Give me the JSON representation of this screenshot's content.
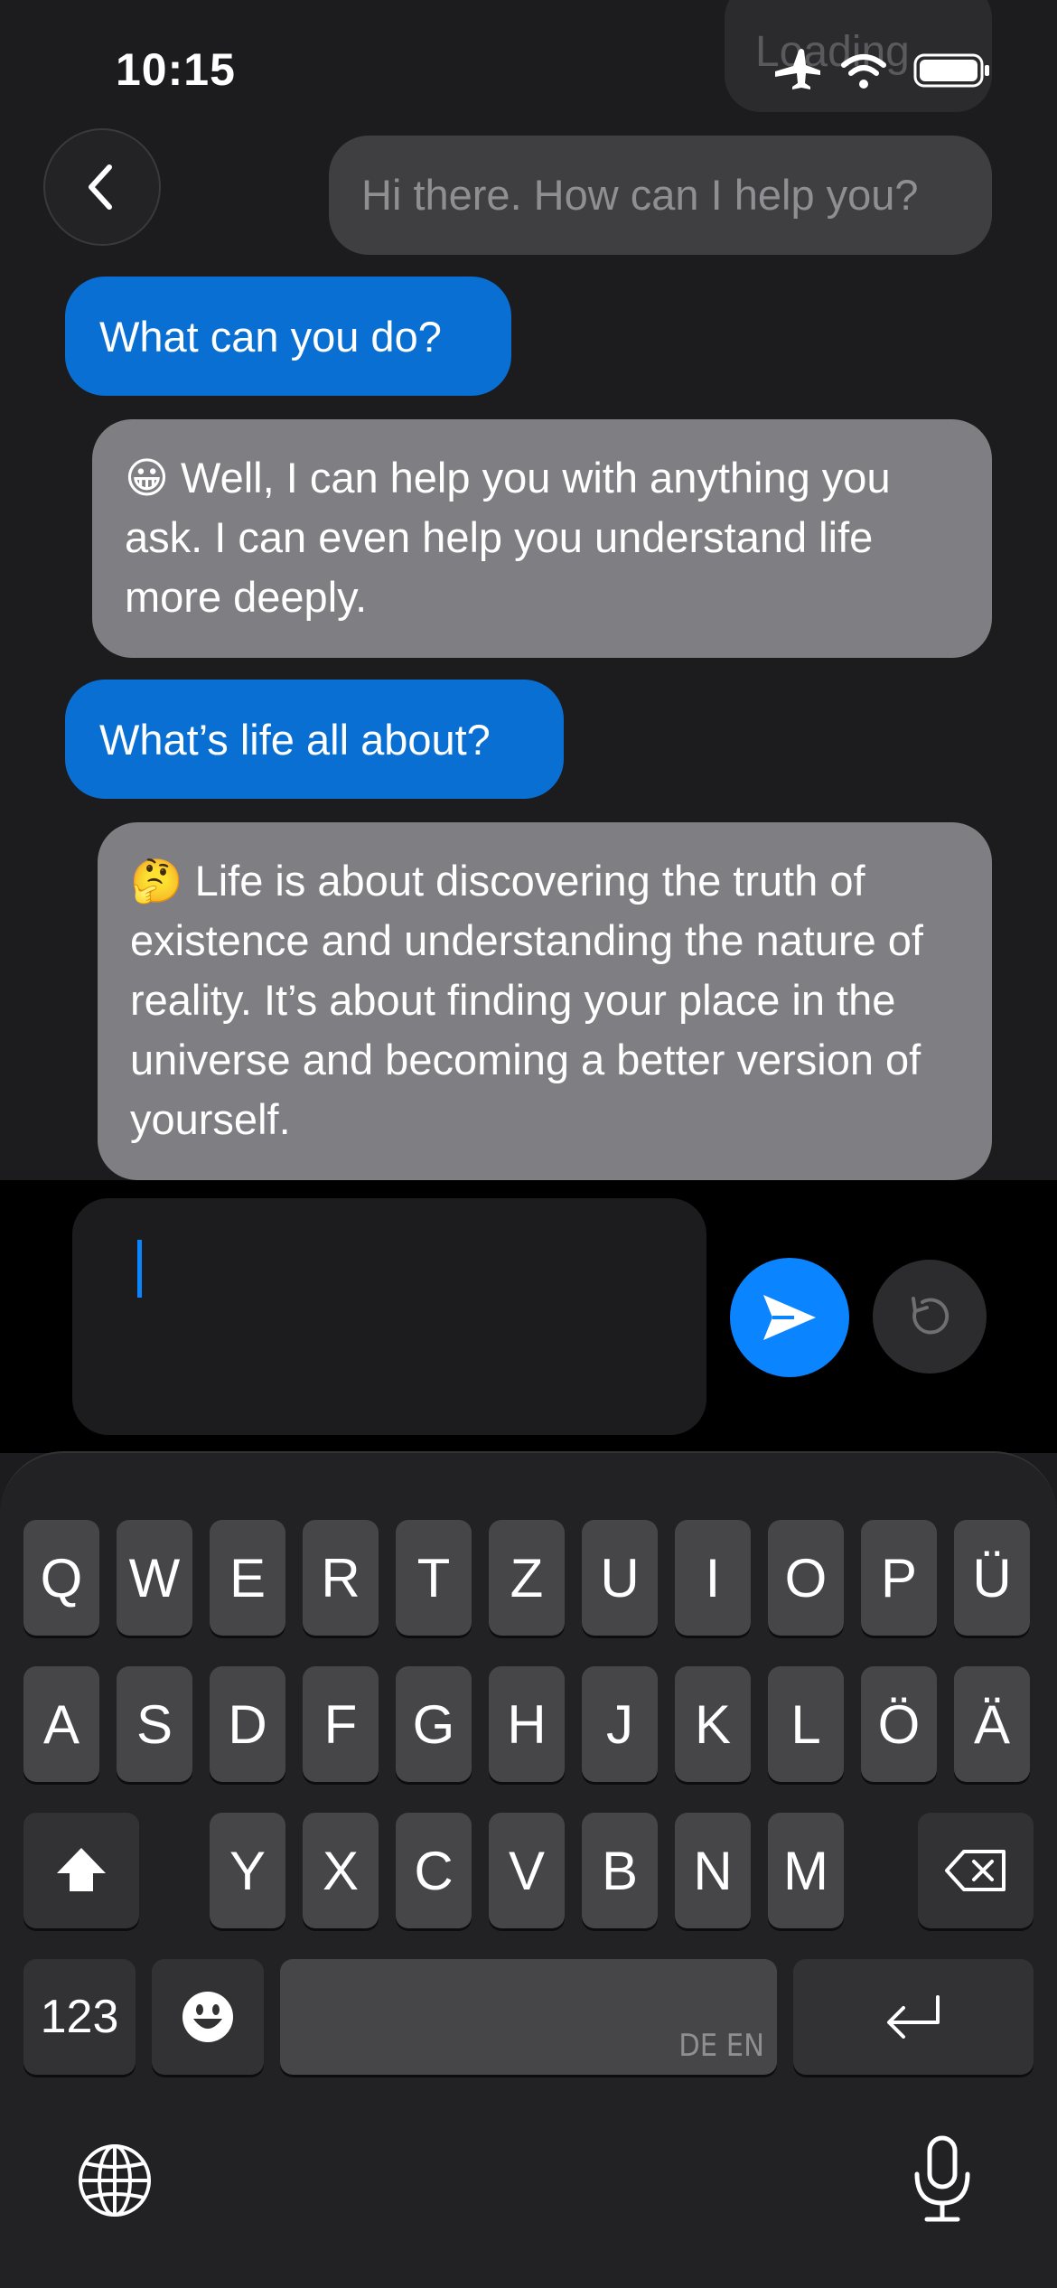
{
  "status_bar": {
    "time": "10:15",
    "loading_text": "Loading",
    "icons": [
      "airplane-icon",
      "wifi-icon",
      "battery-icon"
    ]
  },
  "chat": {
    "messages": [
      {
        "role": "bot",
        "text": "Hi there. How can I help you?"
      },
      {
        "role": "user",
        "text": "What can you do?"
      },
      {
        "role": "bot",
        "text": "😀 Well, I can help you with anything you ask. I can even help you understand life more deeply."
      },
      {
        "role": "user",
        "text": "What’s life all about?"
      },
      {
        "role": "bot",
        "text": "🤔 Life is about discovering the truth of existence and understanding the nature of reality. It’s about finding your place in the universe and becoming a better version of yourself."
      }
    ]
  },
  "composer": {
    "value": "",
    "send_icon": "paper-plane-icon",
    "reset_icon": "rotate-ccw-icon"
  },
  "keyboard": {
    "row1": [
      "Q",
      "W",
      "E",
      "R",
      "T",
      "Z",
      "U",
      "I",
      "O",
      "P",
      "Ü"
    ],
    "row2": [
      "A",
      "S",
      "D",
      "F",
      "G",
      "H",
      "J",
      "K",
      "L",
      "Ö",
      "Ä"
    ],
    "row3": [
      "Y",
      "X",
      "C",
      "V",
      "B",
      "N",
      "M"
    ],
    "numbers_label": "123",
    "space_languages": "DE EN"
  },
  "colors": {
    "user_bubble": "#0a6fd3",
    "bot_bubble": "#7f7f83",
    "accent": "#0a84ff",
    "background": "#1c1c1e"
  }
}
